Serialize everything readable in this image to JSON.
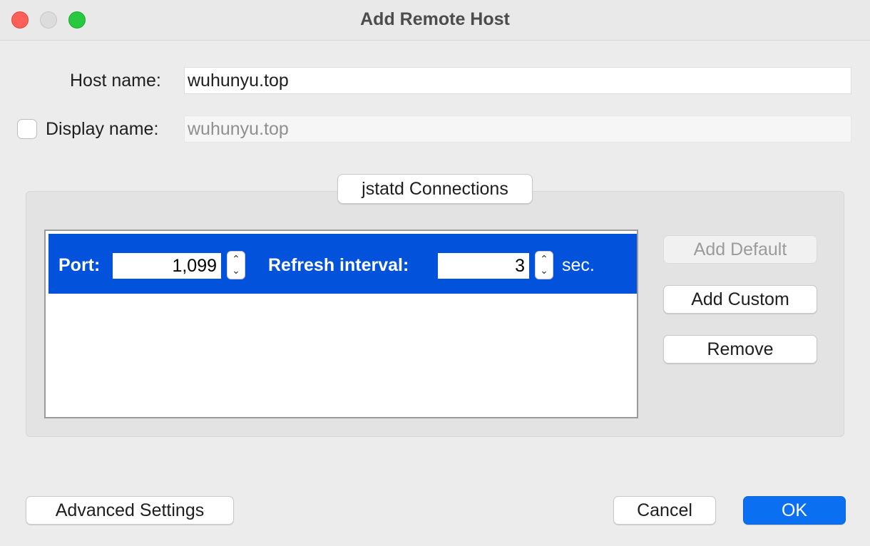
{
  "window": {
    "title": "Add Remote Host"
  },
  "form": {
    "host_name_label": "Host name:",
    "host_name_value": "wuhunyu.top",
    "display_name_checked": false,
    "display_name_label": "Display name:",
    "display_name_value": "wuhunyu.top"
  },
  "connections": {
    "group_title": "jstatd Connections",
    "rows": [
      {
        "port_label": "Port:",
        "port_value": "1,099",
        "refresh_label": "Refresh interval:",
        "refresh_value": "3",
        "unit": "sec.",
        "selected": true
      }
    ],
    "buttons": {
      "add_default": "Add Default",
      "add_custom": "Add Custom",
      "remove": "Remove"
    }
  },
  "footer": {
    "advanced_settings": "Advanced Settings",
    "cancel": "Cancel",
    "ok": "OK"
  },
  "colors": {
    "selection": "#0352db",
    "primary_button": "#0a6ff0",
    "close": "#fe5f57",
    "zoom": "#28c840"
  }
}
